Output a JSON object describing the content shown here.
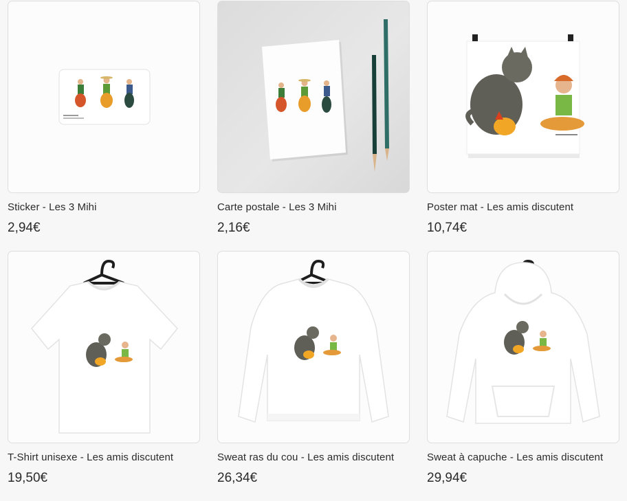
{
  "products": [
    {
      "title": "Sticker - Les 3 Mihi",
      "price": "2,94€",
      "image": "sticker-image"
    },
    {
      "title": "Carte postale - Les 3 Mihi",
      "price": "2,16€",
      "image": "postcard-image"
    },
    {
      "title": "Poster mat - Les amis discutent",
      "price": "10,74€",
      "image": "poster-image"
    },
    {
      "title": "T-Shirt unisexe - Les amis discutent",
      "price": "19,50€",
      "image": "tshirt-image"
    },
    {
      "title": "Sweat ras du cou - Les amis discutent",
      "price": "26,34€",
      "image": "sweatshirt-image"
    },
    {
      "title": "Sweat à capuche - Les amis discutent",
      "price": "29,94€",
      "image": "hoodie-image"
    }
  ],
  "colors": {
    "background": "#f7f7f7",
    "card_border": "#dedede",
    "text": "#2b2b2b"
  }
}
